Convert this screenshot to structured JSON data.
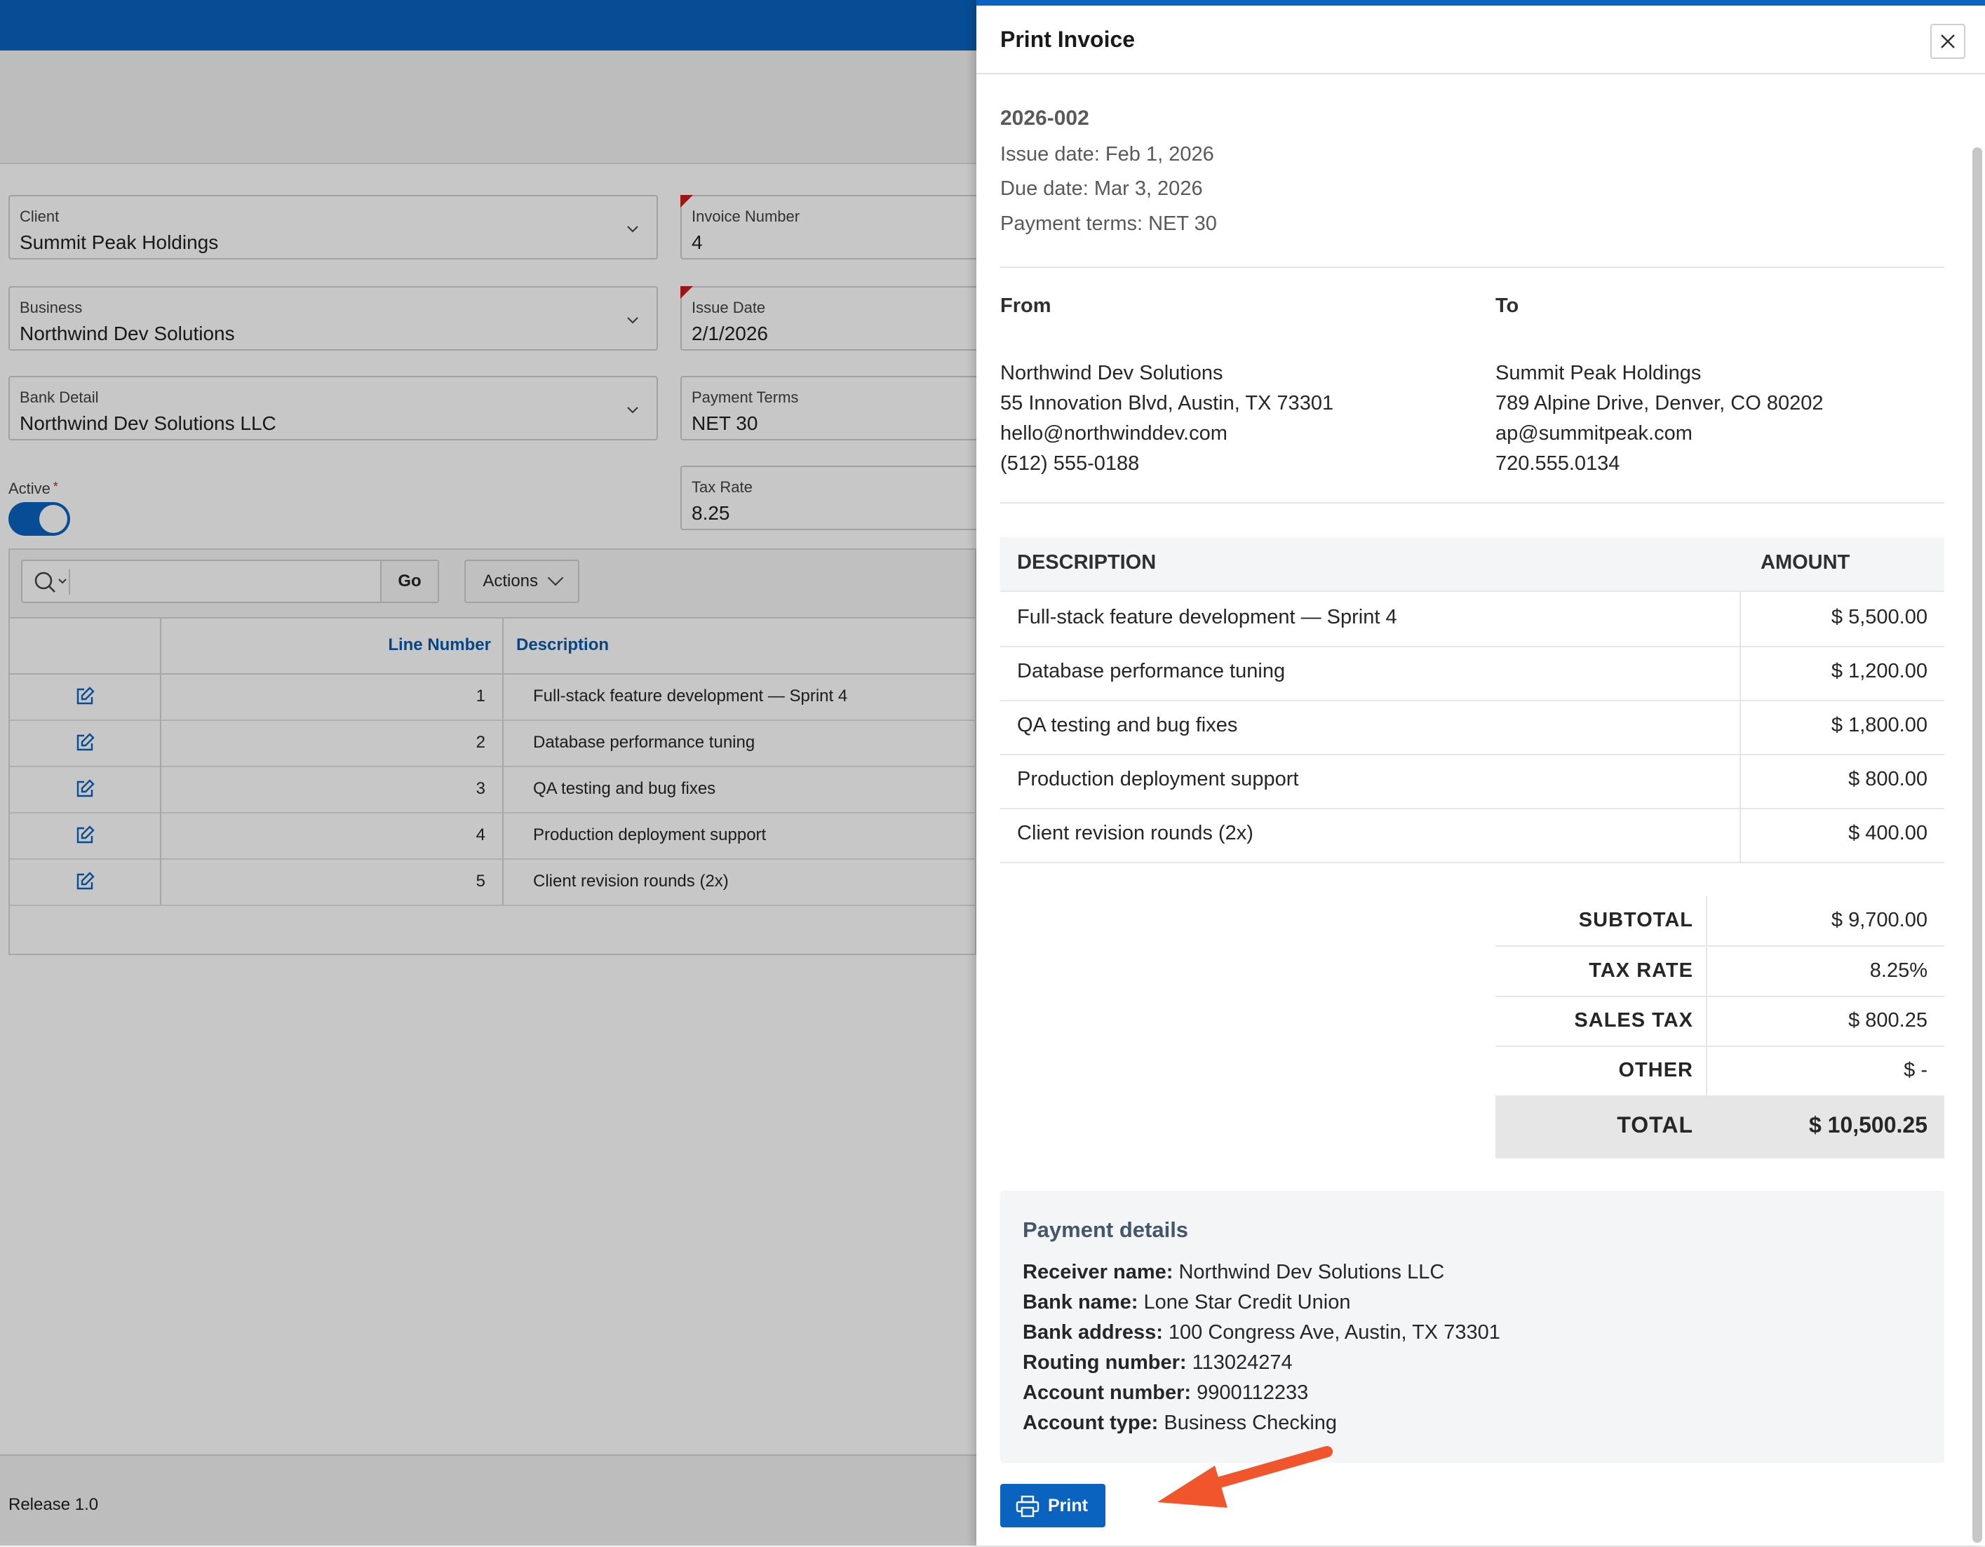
{
  "app": {
    "form": {
      "client": {
        "label": "Client",
        "value": "Summit Peak Holdings"
      },
      "invoice_number": {
        "label": "Invoice Number",
        "value": "4"
      },
      "business": {
        "label": "Business",
        "value": "Northwind Dev Solutions"
      },
      "issue_date": {
        "label": "Issue Date",
        "value": "2/1/2026"
      },
      "bank_detail": {
        "label": "Bank Detail",
        "value": "Northwind Dev Solutions LLC"
      },
      "payment_terms": {
        "label": "Payment Terms",
        "value": "NET 30"
      },
      "active": {
        "label": "Active",
        "required_mark": "*"
      },
      "tax_rate": {
        "label": "Tax Rate",
        "value": "8.25"
      }
    },
    "grid": {
      "go_label": "Go",
      "actions_label": "Actions",
      "columns": [
        "Line Number",
        "Description"
      ],
      "rows": [
        {
          "line": "1",
          "description": "Full-stack feature development — Sprint 4"
        },
        {
          "line": "2",
          "description": "Database performance tuning"
        },
        {
          "line": "3",
          "description": "QA testing and bug fixes"
        },
        {
          "line": "4",
          "description": "Production deployment support"
        },
        {
          "line": "5",
          "description": "Client revision rounds (2x)"
        }
      ]
    },
    "footer": {
      "release": "Release 1.0"
    }
  },
  "dialog": {
    "title": "Print Invoice",
    "invoice_id": "2026-002",
    "issue_date": "Issue date: Feb 1, 2026",
    "due_date": "Due date: Mar 3, 2026",
    "payment_terms": "Payment terms: NET 30",
    "from": {
      "heading": "From",
      "lines": [
        "Northwind Dev Solutions",
        "55 Innovation Blvd, Austin, TX 73301",
        "hello@northwinddev.com",
        "(512) 555-0188"
      ]
    },
    "to": {
      "heading": "To",
      "lines": [
        "Summit Peak Holdings",
        "789 Alpine Drive, Denver, CO 80202",
        "ap@summitpeak.com",
        "720.555.0134"
      ]
    },
    "table": {
      "headers": {
        "description": "DESCRIPTION",
        "amount": "AMOUNT"
      },
      "rows": [
        {
          "description": "Full-stack feature development — Sprint 4",
          "amount": "$ 5,500.00"
        },
        {
          "description": "Database performance tuning",
          "amount": "$ 1,200.00"
        },
        {
          "description": "QA testing and bug fixes",
          "amount": "$ 1,800.00"
        },
        {
          "description": "Production deployment support",
          "amount": "$ 800.00"
        },
        {
          "description": "Client revision rounds (2x)",
          "amount": "$ 400.00"
        }
      ]
    },
    "totals": {
      "subtotal": {
        "label": "SUBTOTAL",
        "value": "$ 9,700.00"
      },
      "tax_rate": {
        "label": "TAX RATE",
        "value": "8.25%"
      },
      "sales_tax": {
        "label": "SALES TAX",
        "value": "$ 800.25"
      },
      "other": {
        "label": "OTHER",
        "value": "$ -"
      },
      "total": {
        "label": "TOTAL",
        "value": "$ 10,500.25"
      }
    },
    "payment": {
      "title": "Payment details",
      "receiver": {
        "label": "Receiver name:",
        "value": "Northwind Dev Solutions LLC"
      },
      "bank": {
        "label": "Bank name:",
        "value": "Lone Star Credit Union"
      },
      "address": {
        "label": "Bank address:",
        "value": "100 Congress Ave, Austin, TX 73301"
      },
      "routing": {
        "label": "Routing number:",
        "value": "113024274"
      },
      "account": {
        "label": "Account number:",
        "value": "9900112233"
      },
      "type": {
        "label": "Account type:",
        "value": "Business Checking"
      }
    },
    "print_label": "Print"
  },
  "colors": {
    "accent": "#0a63bf",
    "annotation_arrow": "#f0552c",
    "required": "#c41e1e"
  },
  "icons": [
    "chevron-down-icon",
    "search-icon",
    "edit-icon",
    "close-icon",
    "printer-icon",
    "arrow-annotation"
  ]
}
